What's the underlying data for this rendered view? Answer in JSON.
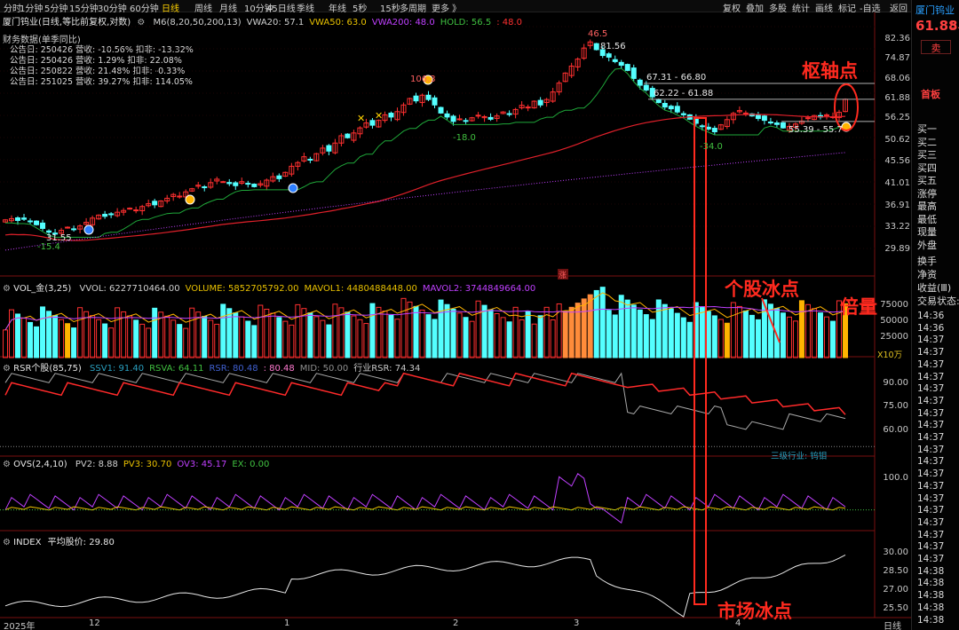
{
  "toolbar": {
    "left_items": [
      "分时",
      "1分钟",
      "5分钟",
      "15分钟",
      "30分钟",
      "60分钟",
      "日线",
      "周线",
      "月线",
      "10分钟",
      "45日线",
      "季线",
      "年线",
      "5秒",
      "15秒",
      "多周期",
      "更多 》"
    ],
    "active": "日线",
    "right_items": [
      "复权",
      "叠加",
      "多股",
      "统计",
      "画线",
      "标记",
      "-自选",
      "返回"
    ]
  },
  "sidebar": {
    "stock_name": "厦门钨业",
    "price": "61.88",
    "price_partial": "5.",
    "sell_button": "卖",
    "home_label": "首板",
    "quote_rows": [
      "买一",
      "买二",
      "买三",
      "买四",
      "买五",
      "涨停",
      "最高",
      "最低",
      "现量",
      "外盘",
      "换手",
      "净资",
      "收益(Ⅲ)",
      "交易状态:"
    ],
    "times": [
      "14:36",
      "14:36",
      "14:37",
      "14:37",
      "14:37",
      "14:37",
      "14:37",
      "14:37",
      "14:37",
      "14:37",
      "14:37",
      "14:37",
      "14:37",
      "14:37",
      "14:37",
      "14:37",
      "14:37",
      "14:37",
      "14:37",
      "14:37",
      "14:37",
      "14:38",
      "14:38",
      "14:38",
      "14:38",
      "14:38"
    ]
  },
  "main": {
    "title": "厦门钨业(日线,等比前复权,对数)",
    "indicators": [
      {
        "text": "M6(8,20,50,200,13)",
        "color": "#d0d0d0"
      },
      {
        "text": "VWA20: 57.1",
        "color": "#d0d0d0"
      },
      {
        "text": "VWA50: 63.0",
        "color": "#e8c000"
      },
      {
        "text": "VWA200: 48.0",
        "color": "#c040ff"
      },
      {
        "text": "HOLD: 56.5",
        "color": "#40c040"
      },
      {
        "text": ": 48.0",
        "color": "#ff3030"
      }
    ],
    "fin_title": "财务数据(单季同比)",
    "fin_rows": [
      "公告日: 250426  营收: -10.56%  扣非: -13.32%",
      "公告日: 250426  营收: 1.29%   扣非: 22.08%",
      "公告日: 250822  营收: 21.48%  扣非: -0.33%",
      "公告日: 251025  营收: 39.27%  扣非: 114.05%"
    ],
    "price_ticks": [
      "82.36",
      "74.87",
      "68.06",
      "61.88",
      "56.25",
      "50.62",
      "45.56",
      "41.01",
      "36.91",
      "33.22",
      "29.89"
    ],
    "price_labels": {
      "high": "81.56",
      "peak_label": "46.5",
      "left_high": "106.3",
      "low_left": "31.55",
      "left_pct": "-15.4",
      "mid_pct": "-18.0",
      "right_pct": "-34.0",
      "band1": "67.31 - 66.80",
      "band2": "62.22 - 61.88",
      "band3": "55.39 - 55.7",
      "limit_mark": "涨"
    }
  },
  "volume": {
    "title": "VOL_金(3,25)",
    "items": [
      {
        "text": "VVOL: 6227710464.00",
        "color": "#d0d0d0"
      },
      {
        "text": "VOLUME: 5852705792.00",
        "color": "#e8c000"
      },
      {
        "text": "MAVOL1: 4480488448.00",
        "color": "#e8c000"
      },
      {
        "text": "MAVOL2: 3744849664.00",
        "color": "#c040ff"
      }
    ],
    "ticks": [
      "75000",
      "50000",
      "25000"
    ],
    "unit": "X10万"
  },
  "rsr": {
    "title": "RSR个股(85,75)",
    "items": [
      {
        "text": "SSV1: 91.40",
        "color": "#2aa0c0"
      },
      {
        "text": "RSVA: 64.11",
        "color": "#40c040"
      },
      {
        "text": "RSR: 80.48",
        "color": "#4060d0"
      },
      {
        "text": ": 80.48",
        "color": "#ff7ad0"
      },
      {
        "text": "MID: 50.00",
        "color": "#909090"
      },
      {
        "text": "行业RSR: 74.34",
        "color": "#c8c8c8"
      }
    ],
    "ticks": [
      "90.00",
      "75.00",
      "60.00"
    ],
    "industry_label": "三级行业: 钨钼"
  },
  "ovs": {
    "title": "OVS(2,4,10)",
    "items": [
      {
        "text": "PV2: 8.88",
        "color": "#d0d0d0"
      },
      {
        "text": "PV3: 30.70",
        "color": "#e8c000"
      },
      {
        "text": "OV3: 45.17",
        "color": "#c040ff"
      },
      {
        "text": "EX: 0.00",
        "color": "#40c040"
      }
    ],
    "ticks": [
      "100.0"
    ]
  },
  "index": {
    "title": "INDEX",
    "item": "平均股价: 29.80",
    "ticks": [
      "30.00",
      "28.50",
      "27.00",
      "25.50"
    ]
  },
  "xaxis": {
    "labels": [
      "2025年",
      "12",
      "1",
      "2",
      "3",
      "4"
    ],
    "period": "日线"
  },
  "annotations": {
    "pivot": "枢轴点",
    "stock_freeze": "个股冰点",
    "double_volume": "倍量",
    "market_freeze": "市场冰点"
  },
  "colors": {
    "up": "#ff3030",
    "down": "#54ffff",
    "annotation": "#ff2a1f",
    "ma_green": "#1fa83a",
    "ma_red": "#e0202a",
    "ma_purple": "#c040ff",
    "vol_orange": "#ff8c3a",
    "vol_gold": "#ffb400"
  }
}
